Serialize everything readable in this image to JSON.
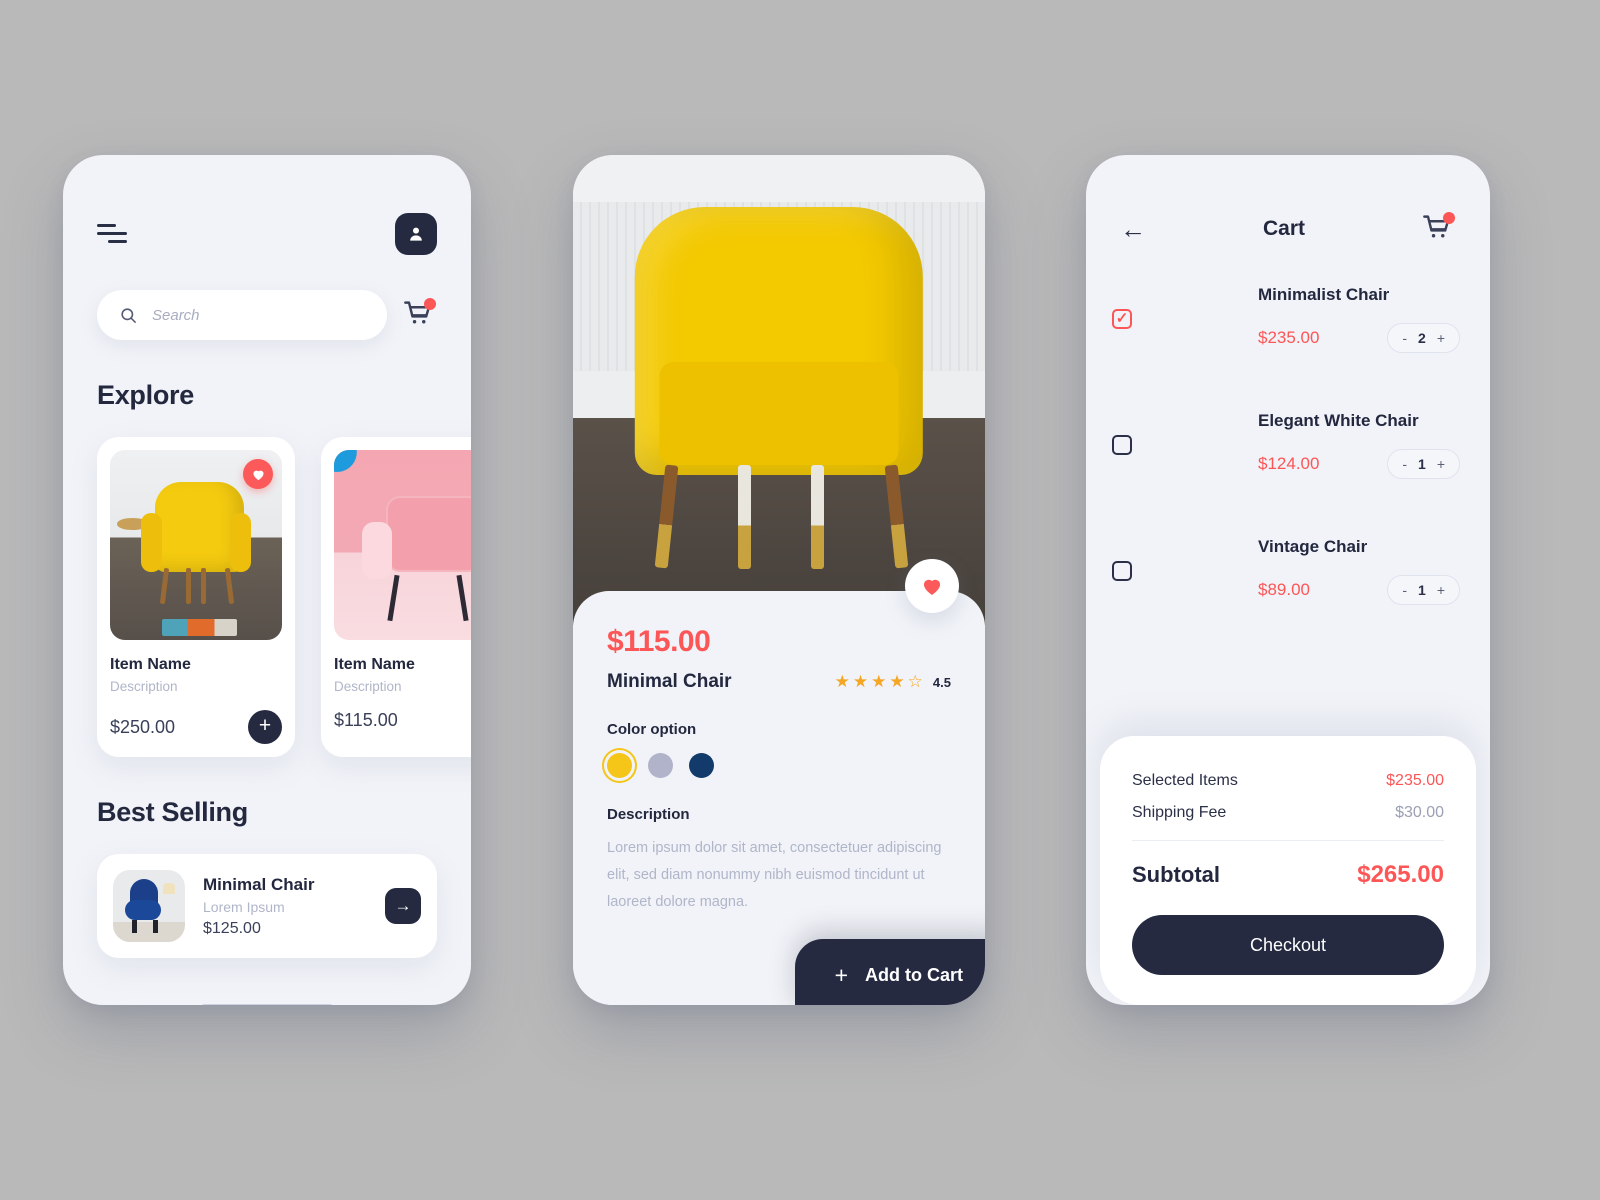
{
  "home": {
    "menu_icon": "hamburger-icon",
    "profile_icon": "user-icon",
    "search": {
      "placeholder": "Search",
      "icon": "search-icon"
    },
    "cart_icon": "cart-icon",
    "explore_title": "Explore",
    "explore_items": [
      {
        "name": "Item Name",
        "description": "Description",
        "price": "$250.00",
        "favorited": true,
        "add_label": "+"
      },
      {
        "name": "Item Name",
        "description": "Description",
        "price": "$115.00",
        "favorited": false
      }
    ],
    "best_selling_title": "Best Selling",
    "best_selling": {
      "name": "Minimal Chair",
      "subtitle": "Lorem Ipsum",
      "price": "$125.00",
      "arrow": "→"
    }
  },
  "detail": {
    "carousel": {
      "dots": 4,
      "active_index": 1
    },
    "favorite_icon": "heart-icon",
    "price": "$115.00",
    "name": "Minimal Chair",
    "rating": {
      "value": "4.5",
      "filled": 4,
      "total": 5
    },
    "color_option_label": "Color option",
    "colors": [
      {
        "name": "yellow",
        "hex": "#f5c518",
        "selected": true
      },
      {
        "name": "lavender-gray",
        "hex": "#b0b3ca",
        "selected": false
      },
      {
        "name": "navy",
        "hex": "#123a6b",
        "selected": false
      }
    ],
    "description_label": "Description",
    "description": "Lorem ipsum dolor sit amet, consectetuer adipiscing elit, sed diam nonummy nibh euismod tincidunt ut laoreet dolore magna.",
    "add_to_cart": {
      "plus": "+",
      "label": "Add to Cart"
    }
  },
  "cart": {
    "back_icon": "arrow-left-icon",
    "title": "Cart",
    "cart_icon": "cart-icon",
    "items": [
      {
        "name": "Minimalist Chair",
        "price": "$235.00",
        "qty": "2",
        "selected": true,
        "minus": "-",
        "plus": "+"
      },
      {
        "name": "Elegant White Chair",
        "price": "$124.00",
        "qty": "1",
        "selected": false,
        "minus": "-",
        "plus": "+"
      },
      {
        "name": "Vintage Chair",
        "price": "$89.00",
        "qty": "1",
        "selected": false,
        "minus": "-",
        "plus": "+"
      }
    ],
    "summary": {
      "selected_items_label": "Selected Items",
      "selected_items_value": "$235.00",
      "shipping_label": "Shipping Fee",
      "shipping_value": "$30.00",
      "subtotal_label": "Subtotal",
      "subtotal_value": "$265.00",
      "checkout_label": "Checkout"
    }
  },
  "theme": {
    "accent_red": "#fc5656",
    "dark": "#252a41",
    "yellow": "#f5c518",
    "bg": "#f1f3f8"
  }
}
